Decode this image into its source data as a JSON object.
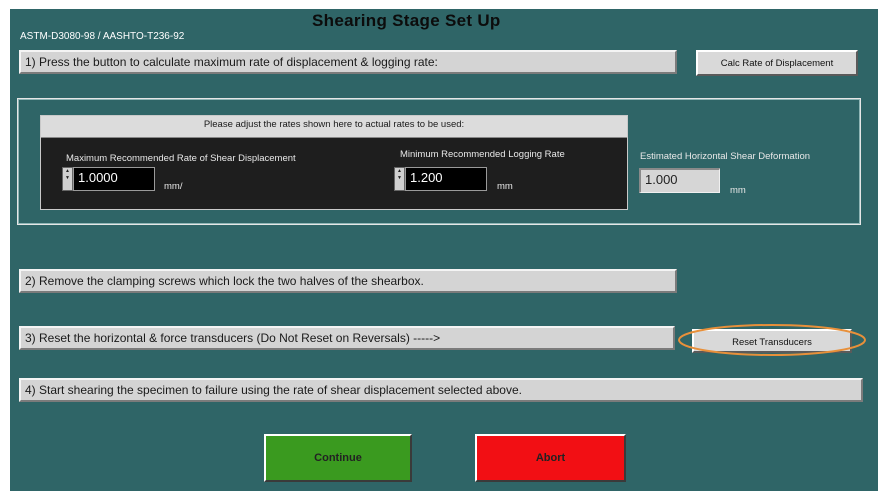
{
  "header": {
    "title": "Shearing Stage Set Up",
    "standard": "ASTM-D3080-98 / AASHTO-T236-92"
  },
  "steps": {
    "step1": "1) Press the button to calculate maximum rate of displacement & logging rate:",
    "step2": "2) Remove the clamping screws which lock the two halves of the shearbox.",
    "step3": "3) Reset the horizontal & force transducers (Do Not Reset on Reversals)  ----->",
    "step4": "4) Start shearing the specimen to failure using the rate of shear displacement selected above."
  },
  "buttons": {
    "calc_label": "Calc Rate of Displacement",
    "reset_label": "Reset Transducers",
    "continue_label": "Continue",
    "abort_label": "Abort"
  },
  "rates": {
    "heading": "Please adjust the rates shown here to actual rates to be used:",
    "max_rate_label": "Maximum Recommended Rate of Shear Displacement",
    "max_rate_value": "1.0000",
    "max_rate_unit": "mm/",
    "min_log_label": "Minimum Recommended Logging Rate",
    "min_log_value": "1.200",
    "min_log_unit": "mm",
    "est_label": "Estimated Horizontal Shear Deformation",
    "est_value": "1.000",
    "est_unit": "mm"
  },
  "colors": {
    "background": "#2f6567",
    "continue": "#3a9a1f",
    "abort": "#f20f14",
    "highlight": "#e8903a"
  }
}
